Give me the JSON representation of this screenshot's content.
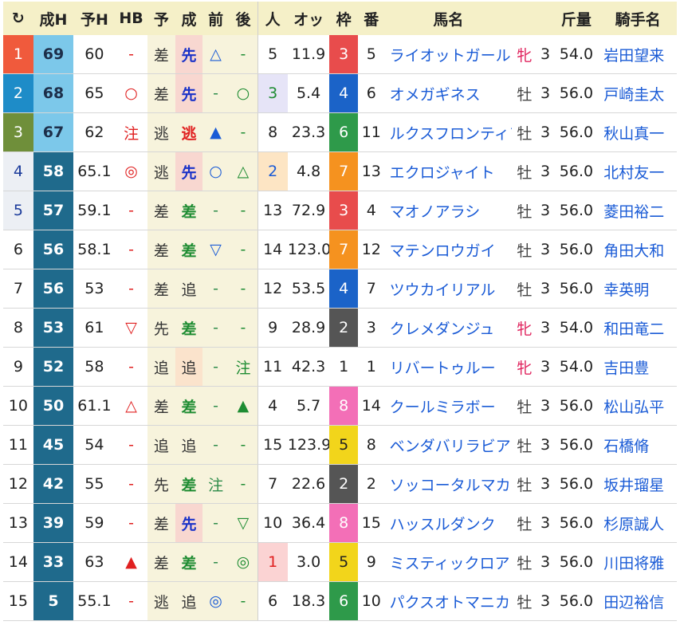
{
  "header": {
    "refresh_icon": "↻",
    "cols": [
      "成H",
      "予H",
      "HB",
      "予",
      "成",
      "前",
      "後",
      "人",
      "オッ",
      "枠",
      "番",
      "馬名",
      "",
      "",
      "斤量",
      "騎手名"
    ]
  },
  "colors": {
    "header_bg": "#f5f0c8",
    "pred_bg": "#f7f3dc",
    "link": "#1a5bd6",
    "mare": "#e0245e",
    "rank_red": "#f05a3c",
    "rank_blue": "#1e8cc8",
    "rank_green": "#6f8f3a",
    "rank_gray": "#eceff4",
    "h_dark": "#1f6a8c",
    "h_light": "#7cc8ea"
  },
  "rows": [
    {
      "rank": "1",
      "h": "69",
      "yh": "60",
      "hb": "-",
      "yo": "差",
      "sei": "先",
      "mae": "△",
      "ato": "-",
      "ninki": "5",
      "odds": "11.9",
      "waku": "3",
      "ban": "5",
      "name": "ライオットガール",
      "sex": "牝",
      "age": "3",
      "kin": "54.0",
      "jockey": "岩田望来"
    },
    {
      "rank": "2",
      "h": "68",
      "yh": "65",
      "hb": "○",
      "yo": "差",
      "sei": "先",
      "mae": "-",
      "ato": "○",
      "ninki": "3",
      "odds": "5.4",
      "waku": "4",
      "ban": "6",
      "name": "オメガギネス",
      "sex": "牡",
      "age": "3",
      "kin": "56.0",
      "jockey": "戸崎圭太"
    },
    {
      "rank": "3",
      "h": "67",
      "yh": "62",
      "hb": "注",
      "yo": "逃",
      "sei": "逃",
      "mae": "▲",
      "ato": "-",
      "ninki": "8",
      "odds": "23.3",
      "waku": "6",
      "ban": "11",
      "name": "ルクスフロンティア",
      "sex": "牡",
      "age": "3",
      "kin": "56.0",
      "jockey": "秋山真一"
    },
    {
      "rank": "4",
      "h": "58",
      "yh": "65.1",
      "hb": "◎",
      "yo": "逃",
      "sei": "先",
      "mae": "○",
      "ato": "△",
      "ninki": "2",
      "odds": "4.8",
      "waku": "7",
      "ban": "13",
      "name": "エクロジャイト",
      "sex": "牡",
      "age": "3",
      "kin": "56.0",
      "jockey": "北村友一"
    },
    {
      "rank": "5",
      "h": "57",
      "yh": "59.1",
      "hb": "-",
      "yo": "差",
      "sei": "差",
      "mae": "-",
      "ato": "-",
      "ninki": "13",
      "odds": "72.9",
      "waku": "3",
      "ban": "4",
      "name": "マオノアラシ",
      "sex": "牡",
      "age": "3",
      "kin": "56.0",
      "jockey": "菱田裕二"
    },
    {
      "rank": "6",
      "h": "56",
      "yh": "58.1",
      "hb": "-",
      "yo": "差",
      "sei": "差",
      "mae": "▽",
      "ato": "-",
      "ninki": "14",
      "odds": "123.0",
      "waku": "7",
      "ban": "12",
      "name": "マテンロウガイ",
      "sex": "牡",
      "age": "3",
      "kin": "56.0",
      "jockey": "角田大和"
    },
    {
      "rank": "7",
      "h": "56",
      "yh": "53",
      "hb": "-",
      "yo": "差",
      "sei": "追",
      "mae": "-",
      "ato": "-",
      "ninki": "12",
      "odds": "53.5",
      "waku": "4",
      "ban": "7",
      "name": "ツウカイリアル",
      "sex": "牡",
      "age": "3",
      "kin": "56.0",
      "jockey": "幸英明"
    },
    {
      "rank": "8",
      "h": "53",
      "yh": "61",
      "hb": "▽",
      "yo": "先",
      "sei": "差",
      "mae": "-",
      "ato": "-",
      "ninki": "9",
      "odds": "28.9",
      "waku": "2",
      "ban": "3",
      "name": "クレメダンジュ",
      "sex": "牝",
      "age": "3",
      "kin": "54.0",
      "jockey": "和田竜二"
    },
    {
      "rank": "9",
      "h": "52",
      "yh": "58",
      "hb": "-",
      "yo": "追",
      "sei": "追",
      "mae": "-",
      "ato": "注",
      "ninki": "11",
      "odds": "42.3",
      "waku": "1",
      "ban": "1",
      "name": "リバートゥルー",
      "sex": "牝",
      "age": "3",
      "kin": "54.0",
      "jockey": "吉田豊"
    },
    {
      "rank": "10",
      "h": "50",
      "yh": "61.1",
      "hb": "△",
      "yo": "差",
      "sei": "差",
      "mae": "-",
      "ato": "▲",
      "ninki": "4",
      "odds": "5.7",
      "waku": "8",
      "ban": "14",
      "name": "クールミラボー",
      "sex": "牡",
      "age": "3",
      "kin": "56.0",
      "jockey": "松山弘平"
    },
    {
      "rank": "11",
      "h": "45",
      "yh": "54",
      "hb": "-",
      "yo": "追",
      "sei": "追",
      "mae": "-",
      "ato": "-",
      "ninki": "15",
      "odds": "123.9",
      "waku": "5",
      "ban": "8",
      "name": "ベンダバリラビア",
      "sex": "牡",
      "age": "3",
      "kin": "56.0",
      "jockey": "石橋脩"
    },
    {
      "rank": "12",
      "h": "42",
      "yh": "55",
      "hb": "-",
      "yo": "先",
      "sei": "差",
      "mae": "注",
      "ato": "-",
      "ninki": "7",
      "odds": "22.6",
      "waku": "2",
      "ban": "2",
      "name": "ソッコータルマカ",
      "sex": "牡",
      "age": "3",
      "kin": "56.0",
      "jockey": "坂井瑠星"
    },
    {
      "rank": "13",
      "h": "39",
      "yh": "59",
      "hb": "-",
      "yo": "差",
      "sei": "先",
      "mae": "-",
      "ato": "▽",
      "ninki": "10",
      "odds": "36.4",
      "waku": "8",
      "ban": "15",
      "name": "ハッスルダンク",
      "sex": "牡",
      "age": "3",
      "kin": "56.0",
      "jockey": "杉原誠人"
    },
    {
      "rank": "14",
      "h": "33",
      "yh": "63",
      "hb": "▲",
      "yo": "差",
      "sei": "差",
      "mae": "-",
      "ato": "◎",
      "ninki": "1",
      "odds": "3.0",
      "waku": "5",
      "ban": "9",
      "name": "ミスティックロア",
      "sex": "牡",
      "age": "3",
      "kin": "56.0",
      "jockey": "川田将雅"
    },
    {
      "rank": "15",
      "h": "5",
      "yh": "55.1",
      "hb": "-",
      "yo": "逃",
      "sei": "追",
      "mae": "◎",
      "ato": "-",
      "ninki": "6",
      "odds": "18.3",
      "waku": "6",
      "ban": "10",
      "name": "パクスオトマニカ",
      "sex": "牡",
      "age": "3",
      "kin": "56.0",
      "jockey": "田辺裕信"
    }
  ]
}
